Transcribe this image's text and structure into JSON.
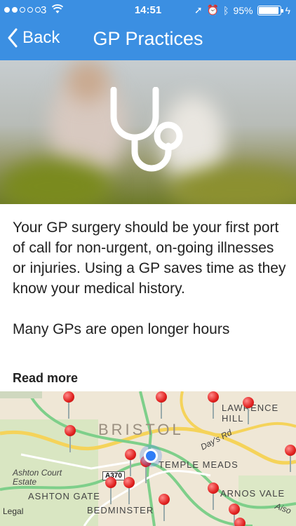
{
  "status": {
    "carrier": "3",
    "time": "14:51",
    "battery": "95%",
    "battery_level": 0.95,
    "signal_bars_filled": 2,
    "signal_bars_total": 5
  },
  "nav": {
    "back_label": "Back",
    "title": "GP Practices"
  },
  "hero": {
    "icon": "stethoscope-icon"
  },
  "content": {
    "paragraph1": "Your GP surgery should be your first port of call for non-urgent, on-going illnesses or injuries. Using a GP saves time as they know your medical history.",
    "paragraph2": "Many GPs are open longer hours",
    "read_more": "Read more"
  },
  "map": {
    "labels": {
      "bristol": "BRISTOL",
      "lawrence_hill": "LAWRENCE HILL",
      "days_rd": "Day's Rd",
      "temple_meads": "TEMPLE MEADS",
      "ashton_court": "Ashton Court Estate",
      "ashton_gate": "ASHTON GATE",
      "bedminster": "BEDMINSTER",
      "arnos_vale": "ARNOS VALE",
      "aiso": "Aiso",
      "a370": "A370",
      "legal": "Legal"
    },
    "accent": "#e0201e"
  },
  "colors": {
    "nav_bg": "#3b8fe2"
  }
}
